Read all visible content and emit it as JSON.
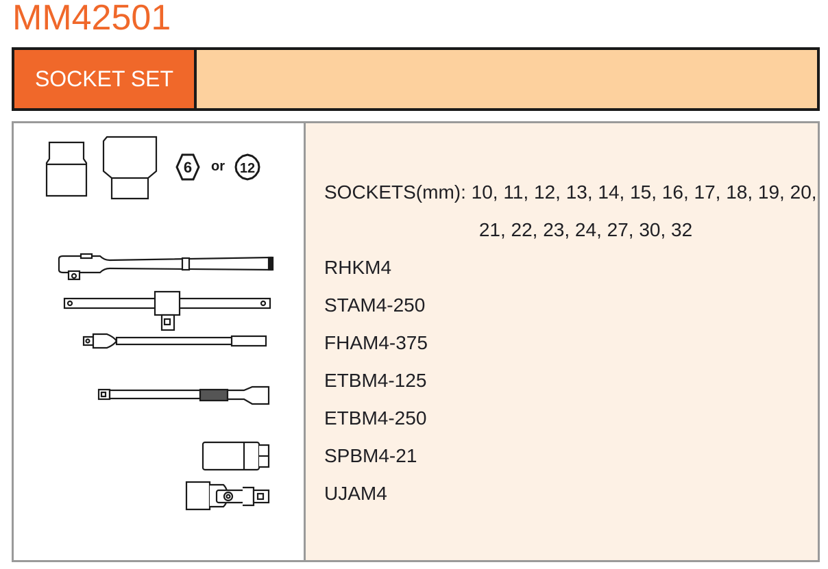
{
  "header": {
    "model": "MM42501",
    "category": "SOCKET SET"
  },
  "socket_icons": {
    "point6": "6",
    "or": "or",
    "point12": "12"
  },
  "contents": {
    "sockets_line1": "SOCKETS(mm): 10, 11, 12, 13, 14, 15, 16, 17, 18, 19, 20,",
    "sockets_line2": "21, 22, 23, 24, 27, 30, 32",
    "items": [
      "RHKM4",
      "STAM4-250",
      "FHAM4-375",
      "ETBM4-125",
      "ETBM4-250",
      "SPBM4-21",
      "UJAM4"
    ]
  },
  "colors": {
    "accent": "#f0682a",
    "banner_fill": "#fdd19e",
    "panel_fill": "#fdf1e5"
  }
}
